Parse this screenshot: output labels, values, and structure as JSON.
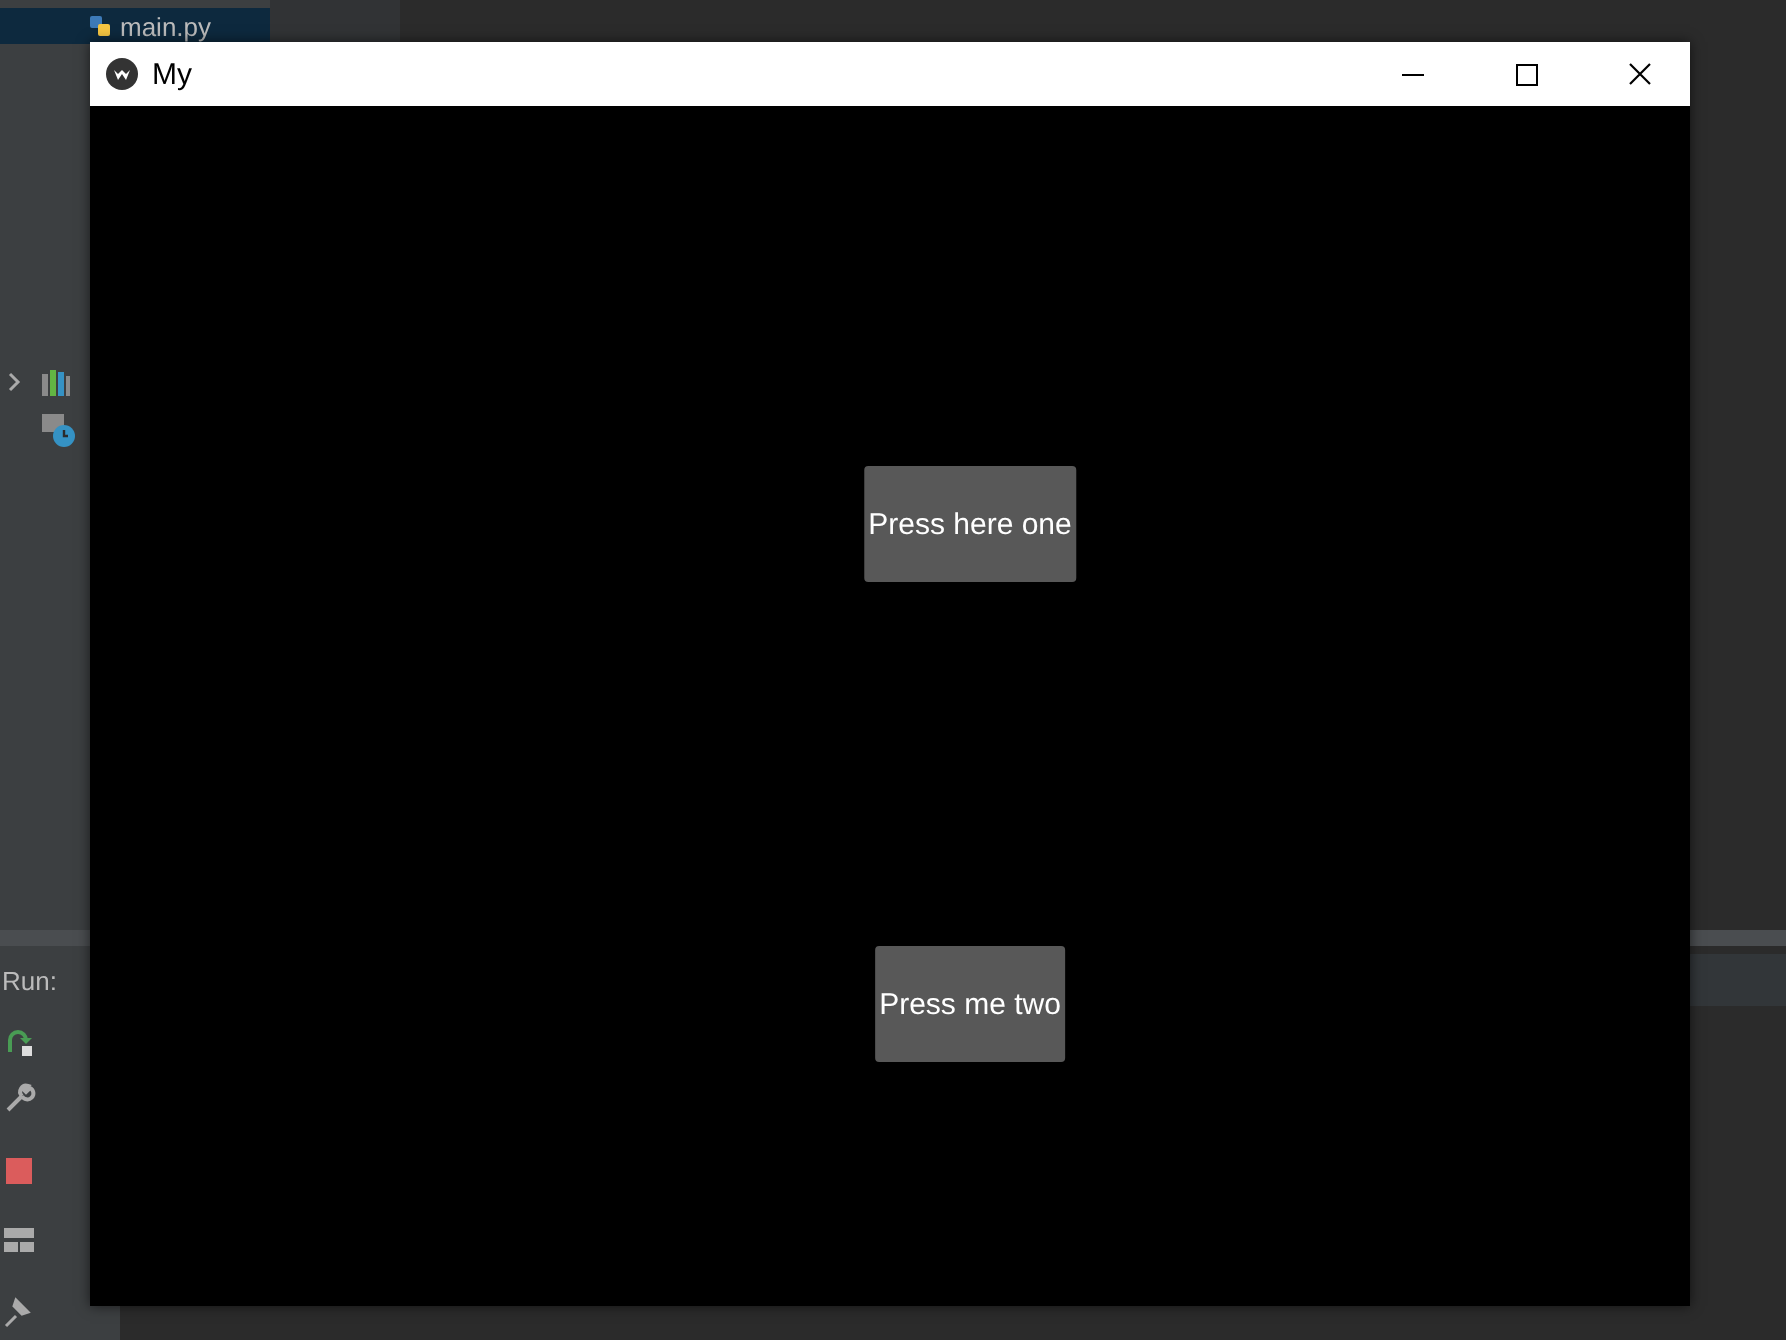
{
  "ide": {
    "project_file": "main.py",
    "run_label": "Run:"
  },
  "window": {
    "title": "My"
  },
  "buttons": [
    {
      "label": "Press here one"
    },
    {
      "label": "Press me two"
    }
  ]
}
